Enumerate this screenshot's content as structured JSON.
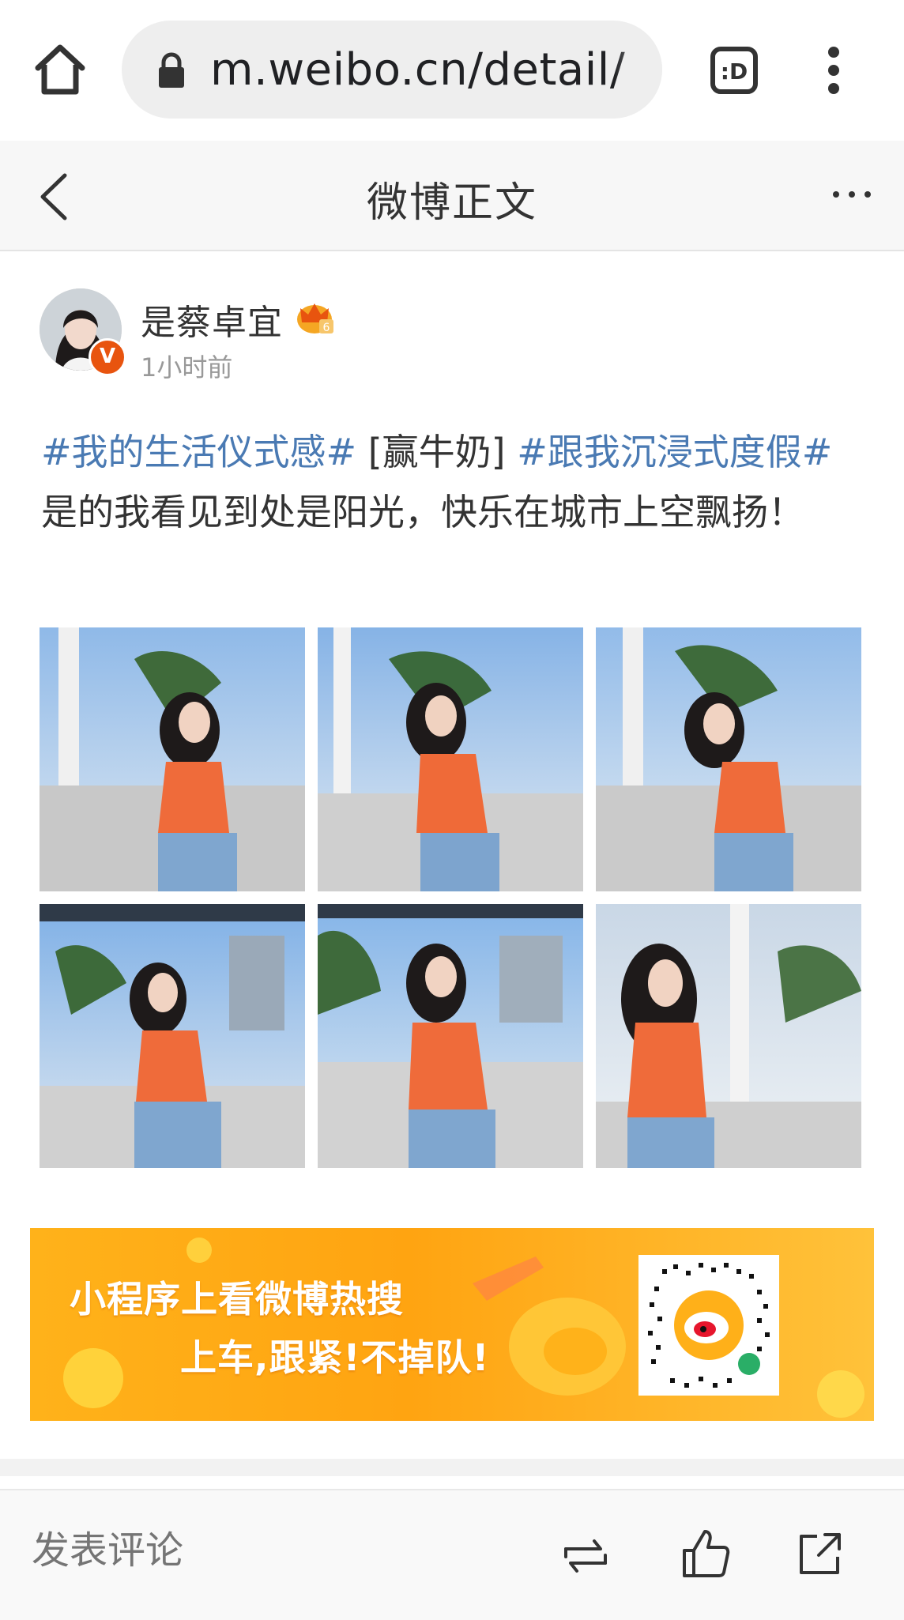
{
  "browser": {
    "url": "m.weibo.cn/detail/"
  },
  "nav": {
    "title": "微博正文"
  },
  "post": {
    "username": "是蔡卓宜",
    "verified_badge": "V",
    "timestamp": "1小时前",
    "text": {
      "hashtag1": "#我的生活仪式感#",
      "emoji_tag": " [赢牛奶] ",
      "hashtag2": "#跟我沉浸式度假#",
      "body": "是的我看见到处是阳光，快乐在城市上空飘扬！"
    },
    "photos": [
      {
        "label": "photo-1"
      },
      {
        "label": "photo-2"
      },
      {
        "label": "photo-3"
      },
      {
        "label": "photo-4"
      },
      {
        "label": "photo-5"
      },
      {
        "label": "photo-6"
      }
    ]
  },
  "banner": {
    "line1": "小程序上看微博热搜",
    "line2": "上车,跟紧!不掉队!"
  },
  "bottom_bar": {
    "comment_placeholder": "发表评论"
  },
  "colors": {
    "hashtag": "#4a7ab3",
    "banner": "#ffa411",
    "verify": "#e8540f"
  }
}
